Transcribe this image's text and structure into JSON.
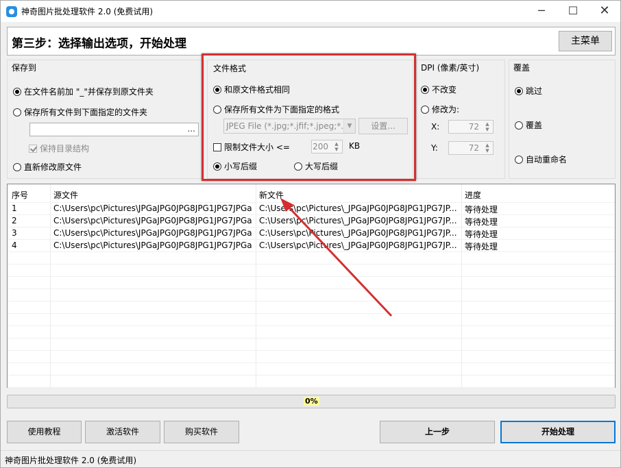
{
  "window": {
    "title": "神奇图片批处理软件 2.0 (免费试用)",
    "minimize_glyph": "─",
    "maximize_glyph": "☐",
    "close_glyph": "✕"
  },
  "header": {
    "step_title": "第三步：选择输出选项，开始处理",
    "main_menu_label": "主菜单"
  },
  "save_to": {
    "title": "保存到",
    "opt_prefix": "在文件名前加 \"_\"并保存到原文件夹",
    "opt_folder": "保存所有文件到下面指定的文件夹",
    "folder_value": "",
    "browse_label": "...",
    "keep_structure": "保持目录结构",
    "opt_overwrite": "直新修改原文件"
  },
  "file_format": {
    "title": "文件格式",
    "opt_same": "和原文件格式相同",
    "opt_specified": "保存所有文件为下面指定的格式",
    "format_value": "JPEG File (*.jpg;*.jfif;*.jpeg;*.jpe)",
    "settings_label": "设置...",
    "limit_size_label": "限制文件大小  <=",
    "limit_size_value": "200",
    "limit_size_unit": "KB",
    "opt_lower_ext": "小写后缀",
    "opt_upper_ext": "大写后缀"
  },
  "dpi": {
    "title": "DPI (像素/英寸)",
    "opt_no_change": "不改变",
    "opt_change": "修改为:",
    "x_label": "X:",
    "x_value": "72",
    "y_label": "Y:",
    "y_value": "72"
  },
  "overwrite": {
    "title": "覆盖",
    "opt_skip": "跳过",
    "opt_overwrite": "覆盖",
    "opt_rename": "自动重命名"
  },
  "table": {
    "headers": [
      "序号",
      "源文件",
      "新文件",
      "进度"
    ],
    "rows": [
      [
        "1",
        "C:\\Users\\pc\\Pictures\\JPGaJPG0JPG8JPG1JPG7JPGa...",
        "C:\\Users\\pc\\Pictures\\_JPGaJPG0JPG8JPG1JPG7JP...",
        "等待处理"
      ],
      [
        "2",
        "C:\\Users\\pc\\Pictures\\JPGaJPG0JPG8JPG1JPG7JPGa...",
        "C:\\Users\\pc\\Pictures\\_JPGaJPG0JPG8JPG1JPG7JP...",
        "等待处理"
      ],
      [
        "3",
        "C:\\Users\\pc\\Pictures\\JPGaJPG0JPG8JPG1JPG7JPGa...",
        "C:\\Users\\pc\\Pictures\\_JPGaJPG0JPG8JPG1JPG7JP...",
        "等待处理"
      ],
      [
        "4",
        "C:\\Users\\pc\\Pictures\\JPGaJPG0JPG8JPG1JPG7JPGa...",
        "C:\\Users\\pc\\Pictures\\_JPGaJPG0JPG8JPG1JPG7JP...",
        "等待处理"
      ]
    ]
  },
  "progress": {
    "label": "0%",
    "fraction": 0
  },
  "buttons": {
    "tutorial": "使用教程",
    "activate": "激活软件",
    "buy": "购买软件",
    "prev": "上一步",
    "start": "开始处理"
  },
  "status": {
    "text": "神奇图片批处理软件 2.0 (免费试用)"
  },
  "colors": {
    "highlight": "#d32f2f",
    "accent": "#0078d7",
    "arrow": "#d32f2f"
  }
}
